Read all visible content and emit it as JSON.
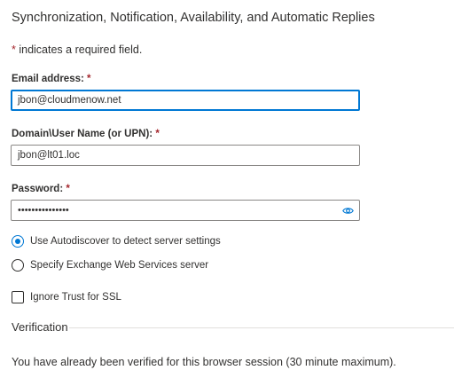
{
  "title": "Synchronization, Notification, Availability, and Automatic Replies",
  "required_note": {
    "star": "*",
    "text": " indicates a required field."
  },
  "email": {
    "label": "Email address: ",
    "star": "*",
    "value": "jbon@cloudmenow.net"
  },
  "username": {
    "label": "Domain\\User Name (or UPN): ",
    "star": "*",
    "value": "jbon@lt01.loc"
  },
  "password": {
    "label": "Password: ",
    "star": "*",
    "value": "•••••••••••••••",
    "reveal_icon": "eye-icon"
  },
  "server_options": {
    "autodiscover_label": "Use Autodiscover to detect server settings",
    "autodiscover_selected": true,
    "ews_label": "Specify Exchange Web Services server",
    "ews_selected": false
  },
  "ignore_trust": {
    "label": "Ignore Trust for SSL",
    "checked": false
  },
  "verification": {
    "header": "Verification",
    "message": "You have already been verified for this browser session (30 minute maximum)."
  },
  "colors": {
    "accent": "#0078d4",
    "required": "#a4262c",
    "text": "#323130",
    "border": "#8a8886"
  }
}
